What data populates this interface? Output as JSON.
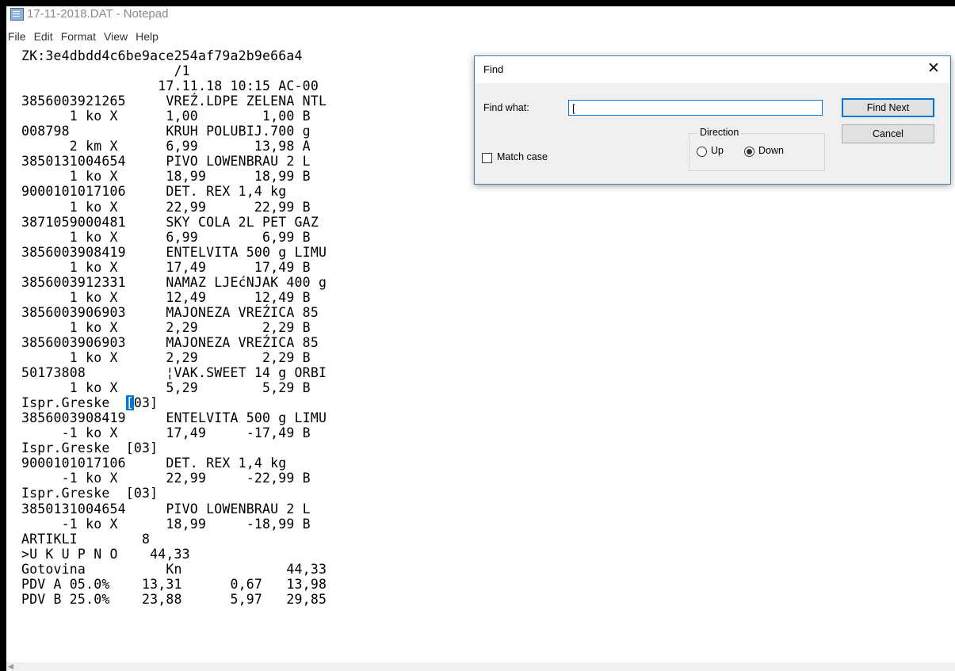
{
  "window": {
    "title": "17-11-2018.DAT - Notepad"
  },
  "menu": [
    "File",
    "Edit",
    "Format",
    "View",
    "Help"
  ],
  "editor": {
    "lines": [
      "ZK:3e4dbdd4c6be9ace254af79a2b9e66a4",
      "                   /1",
      "                 17.11.18 10:15 AC-00",
      "3856003921265     VREŹ.LDPE ZELENA NTL",
      "      1 ko X      1,00        1,00 B",
      "008798            KRUH POLUBIJ.700 g",
      "      2 km X      6,99       13,98 A",
      "3850131004654     PIVO LOWENBRAU 2 L",
      "      1 ko X      18,99      18,99 B",
      "9000101017106     DET. REX 1,4 kg",
      "      1 ko X      22,99      22,99 B",
      "3871059000481     SKY COLA 2L PET GAZ",
      "      1 ko X      6,99        6,99 B",
      "3856003908419     ENTELVITA 500 g LIMU",
      "      1 ko X      17,49      17,49 B",
      "3856003912331     NAMAZ LJEćNJAK 400 g",
      "      1 ko X      12,49      12,49 B",
      "3856003906903     MAJONEZA VREŹICA 85",
      "      1 ko X      2,29        2,29 B",
      "3856003906903     MAJONEZA VREŹICA 85",
      "      1 ko X      2,29        2,29 B",
      "50173808          ¦VAK.SWEET 14 g ORBI",
      "      1 ko X      5,29        5,29 B",
      "Ispr.Greske  [03]",
      "3856003908419     ENTELVITA 500 g LIMU",
      "     -1 ko X      17,49     -17,49 B",
      "Ispr.Greske  [03]",
      "9000101017106     DET. REX 1,4 kg",
      "     -1 ko X      22,99     -22,99 B",
      "Ispr.Greske  [03]",
      "3850131004654     PIVO LOWENBRAU 2 L",
      "     -1 ko X      18,99     -18,99 B",
      "ARTIKLI        8",
      ">U K U P N O    44,33",
      "Gotovina          Kn             44,33",
      "PDV A 05.0%    13,31      0,67   13,98",
      "PDV B 25.0%    23,88      5,97   29,85"
    ],
    "selection": {
      "line": 23,
      "before": "Ispr.Greske  ",
      "selected": "[",
      "after": "03]"
    }
  },
  "find_dialog": {
    "title": "Find",
    "find_what_label": "Find what:",
    "find_what_value": "[",
    "find_next_label": "Find Next",
    "cancel_label": "Cancel",
    "direction_label": "Direction",
    "up_label": "Up",
    "down_label": "Down",
    "direction_selected": "Down",
    "match_case_label": "Match case",
    "match_case_checked": false
  }
}
